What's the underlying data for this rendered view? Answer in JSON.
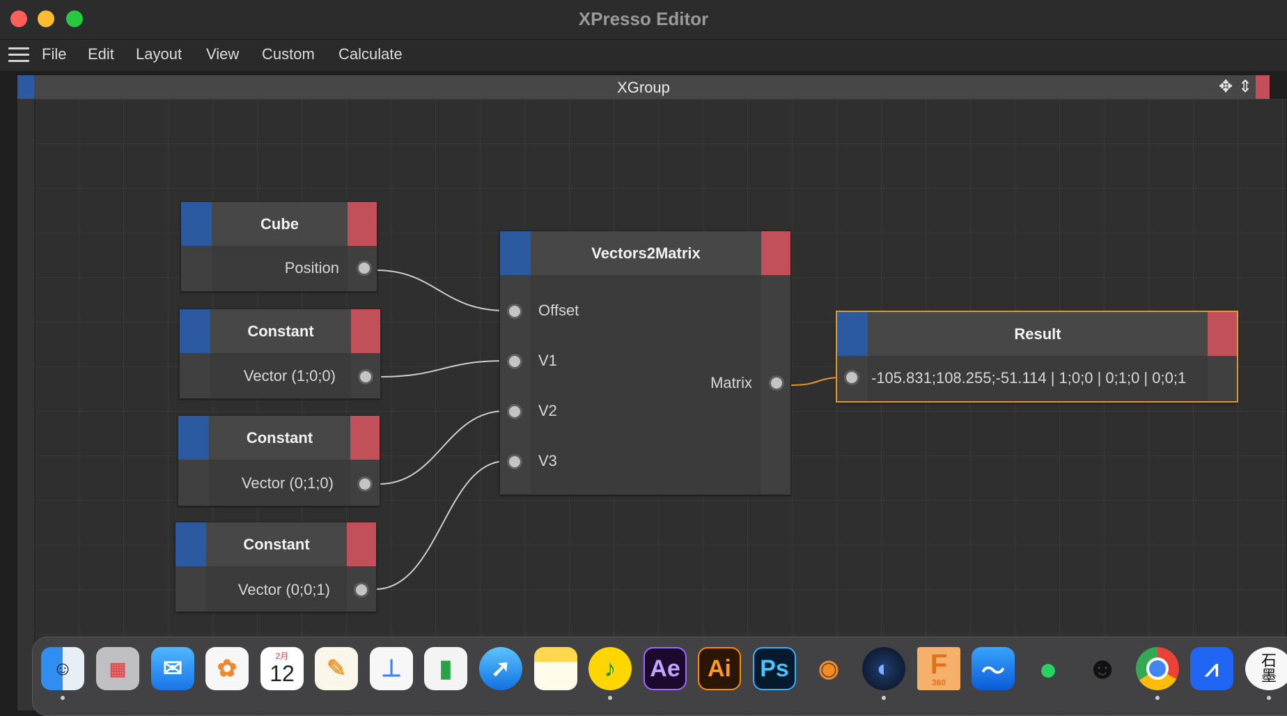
{
  "window": {
    "title": "XPresso Editor"
  },
  "menu": {
    "items": [
      "File",
      "Edit",
      "Layout",
      "View",
      "Custom",
      "Calculate"
    ]
  },
  "xgroup": {
    "title": "XGroup"
  },
  "nodes": {
    "cube": {
      "title": "Cube",
      "output": "Position"
    },
    "constant1": {
      "title": "Constant",
      "output": "Vector (1;0;0)"
    },
    "constant2": {
      "title": "Constant",
      "output": "Vector (0;1;0)"
    },
    "constant3": {
      "title": "Constant",
      "output": "Vector (0;0;1)"
    },
    "v2m": {
      "title": "Vectors2Matrix",
      "inputs": [
        "Offset",
        "V1",
        "V2",
        "V3"
      ],
      "output": "Matrix"
    },
    "result": {
      "title": "Result",
      "value": "-105.831;108.255;-51.114 | 1;0;0 | 0;1;0 | 0;0;1"
    }
  },
  "colors": {
    "node_input_cap": "#2c5aa0",
    "node_output_cap": "#c2505a",
    "selection": "#e69a25",
    "wire": "#cfcfcf"
  },
  "dock": {
    "apps": [
      {
        "name": "Finder",
        "icon": "finder-icon",
        "label": ""
      },
      {
        "name": "Launchpad",
        "icon": "launchpad-icon",
        "label": ""
      },
      {
        "name": "Mail",
        "icon": "mail-icon",
        "label": ""
      },
      {
        "name": "Photos",
        "icon": "photos-icon",
        "label": ""
      },
      {
        "name": "Calendar",
        "icon": "calendar-icon",
        "label": "12",
        "sublabel": "2月"
      },
      {
        "name": "Pages",
        "icon": "pages-icon",
        "label": ""
      },
      {
        "name": "Keynote",
        "icon": "keynote-icon",
        "label": ""
      },
      {
        "name": "Numbers",
        "icon": "numbers-icon",
        "label": ""
      },
      {
        "name": "Safari",
        "icon": "safari-icon",
        "label": ""
      },
      {
        "name": "Notes",
        "icon": "notes-icon",
        "label": ""
      },
      {
        "name": "QQ Music",
        "icon": "music-icon",
        "label": ""
      },
      {
        "name": "After Effects",
        "icon": "ae-icon",
        "label": "Ae"
      },
      {
        "name": "Illustrator",
        "icon": "ai-icon",
        "label": "Ai"
      },
      {
        "name": "Photoshop",
        "icon": "ps-icon",
        "label": "Ps"
      },
      {
        "name": "Blender",
        "icon": "blender-icon",
        "label": ""
      },
      {
        "name": "Cinema 4D",
        "icon": "c4d-icon",
        "label": ""
      },
      {
        "name": "Fusion 360",
        "icon": "fusion-icon",
        "label": "360"
      },
      {
        "name": "Eudic",
        "icon": "eudic-icon",
        "label": ""
      },
      {
        "name": "WeChat",
        "icon": "wechat-icon",
        "label": ""
      },
      {
        "name": "QQ",
        "icon": "qq-icon",
        "label": ""
      },
      {
        "name": "Chrome",
        "icon": "chrome-icon",
        "label": ""
      },
      {
        "name": "Lark",
        "icon": "lark-icon",
        "label": ""
      },
      {
        "name": "Shimo",
        "icon": "shimo-icon",
        "label": "石墨"
      }
    ]
  }
}
